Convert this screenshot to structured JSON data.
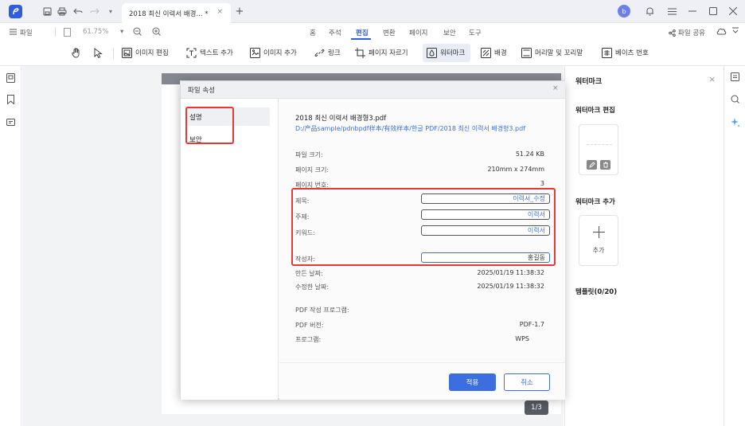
{
  "titlebar": {
    "tab_title": "2018 최신 이력서 배경... *",
    "tab_close": "×",
    "new_tab": "+",
    "avatar_letter": "b",
    "dropdown": "▾"
  },
  "menubar": {
    "file_label": "파일",
    "zoom": "61.75%",
    "menu_items": [
      "홈",
      "주석",
      "편집",
      "변환",
      "페이지",
      "보안",
      "도구"
    ],
    "active_menu": "편집",
    "share_label": "파일 공유"
  },
  "toolbar": {
    "tools": [
      "이미지 편집",
      "텍스트 추가",
      "이미지 추가",
      "링크",
      "페이지 자르기",
      "워터마크",
      "배경",
      "머리말 및 꼬리말",
      "베이츠 번호"
    ]
  },
  "canvas": {
    "page_indicator": "1/3"
  },
  "right_panel": {
    "title": "워터마크",
    "edit_section": "워터마크 편집",
    "add_section": "워터마크 추가",
    "add_label": "추가",
    "template_label": "템플릿(0/20)"
  },
  "dialog": {
    "title": "파일 속성",
    "nav": [
      "설명",
      "보안"
    ],
    "file_name": "2018 최신 이력서 배경형3.pdf",
    "file_path": "D:/产品sample/pdnbpdf样本/有效样本/한글 PDF/2018 최신 이력서 배경형3.pdf",
    "props": [
      {
        "label": "파일 크기:",
        "value": "51.24 KB"
      },
      {
        "label": "페이지 크기:",
        "value": "210mm x 274mm"
      },
      {
        "label": "페이지 번호:",
        "value": "3"
      }
    ],
    "fields": [
      {
        "label": "제목:",
        "value": "이력서_수정"
      },
      {
        "label": "주제:",
        "value": "이력서"
      },
      {
        "label": "키워드:",
        "value": "이력서"
      },
      {
        "label": "작성자:",
        "value": "홍길동"
      }
    ],
    "dates": [
      {
        "label": "만든 날짜:",
        "value": "2025/01/19 11:38:32"
      },
      {
        "label": "수정한 날짜:",
        "value": "2025/01/19 11:38:32"
      }
    ],
    "pdf_info": [
      {
        "label": "PDF 작성 프로그램:",
        "value": ""
      },
      {
        "label": "PDF 버전:",
        "value": "PDF-1.7"
      },
      {
        "label": "프로그램:",
        "value": "WPS"
      }
    ],
    "apply": "적용",
    "cancel": "취소",
    "close": "×"
  },
  "colors": {
    "accent": "#3b6fe0",
    "highlight": "#e53935",
    "brand": "#2f5de0"
  }
}
